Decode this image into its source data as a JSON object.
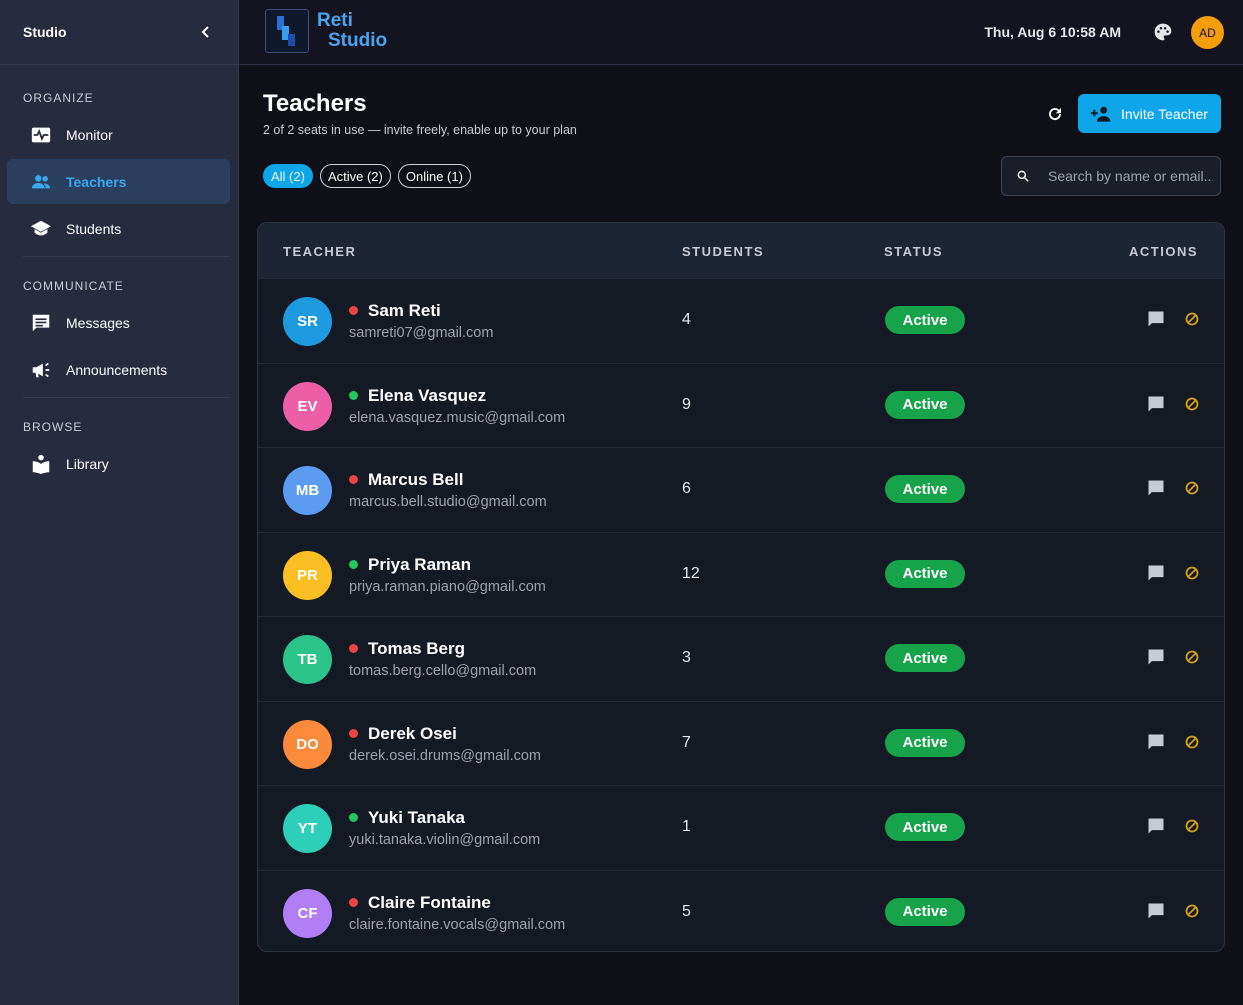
{
  "sidebar": {
    "title": "Studio",
    "sections": {
      "organize": "ORGANIZE",
      "communicate": "COMMUNICATE",
      "browse": "BROWSE"
    },
    "items": {
      "monitor": "Monitor",
      "teachers": "Teachers",
      "students": "Students",
      "messages": "Messages",
      "announcements": "Announcements",
      "library": "Library"
    }
  },
  "topbar": {
    "logo_line1": "Reti",
    "logo_line2": "Studio",
    "datetime": "Thu, Aug 6 10:58 AM",
    "avatar_initials": "AD"
  },
  "page": {
    "title": "Teachers",
    "subtitle": "2 of 2 seats in use — invite freely, enable up to your plan",
    "invite_label": "Invite Teacher",
    "filters": [
      "All (2)",
      "Active (2)",
      "Online (1)"
    ],
    "search_placeholder": "Search by name or email..."
  },
  "table": {
    "headers": {
      "teacher": "TEACHER",
      "students": "STUDENTS",
      "status": "STATUS",
      "actions": "ACTIONS"
    },
    "rows": [
      {
        "initials": "SR",
        "name": "Sam Reti",
        "email": "samreti07@gmail.com",
        "students": "4",
        "status": "Active",
        "online": false,
        "avatar_color": "#1e9be0"
      },
      {
        "initials": "EV",
        "name": "Elena Vasquez",
        "email": "elena.vasquez.music@gmail.com",
        "students": "9",
        "status": "Active",
        "online": true,
        "avatar_color": "#ec5fa6"
      },
      {
        "initials": "MB",
        "name": "Marcus Bell",
        "email": "marcus.bell.studio@gmail.com",
        "students": "6",
        "status": "Active",
        "online": false,
        "avatar_color": "#5b9cf2"
      },
      {
        "initials": "PR",
        "name": "Priya Raman",
        "email": "priya.raman.piano@gmail.com",
        "students": "12",
        "status": "Active",
        "online": true,
        "avatar_color": "#fbbf24"
      },
      {
        "initials": "TB",
        "name": "Tomas Berg",
        "email": "tomas.berg.cello@gmail.com",
        "students": "3",
        "status": "Active",
        "online": false,
        "avatar_color": "#2bc48a"
      },
      {
        "initials": "DO",
        "name": "Derek Osei",
        "email": "derek.osei.drums@gmail.com",
        "students": "7",
        "status": "Active",
        "online": false,
        "avatar_color": "#fb8a3c"
      },
      {
        "initials": "YT",
        "name": "Yuki Tanaka",
        "email": "yuki.tanaka.violin@gmail.com",
        "students": "1",
        "status": "Active",
        "online": true,
        "avatar_color": "#2dcfb8"
      },
      {
        "initials": "CF",
        "name": "Claire Fontaine",
        "email": "claire.fontaine.vocals@gmail.com",
        "students": "5",
        "status": "Active",
        "online": false,
        "avatar_color": "#b07ef5"
      }
    ]
  },
  "colors": {
    "accent": "#0ea5e9",
    "active_badge": "#16a34a",
    "online_dot": "#22c55e",
    "offline_dot": "#ef4444",
    "block_icon": "#d4a017"
  }
}
